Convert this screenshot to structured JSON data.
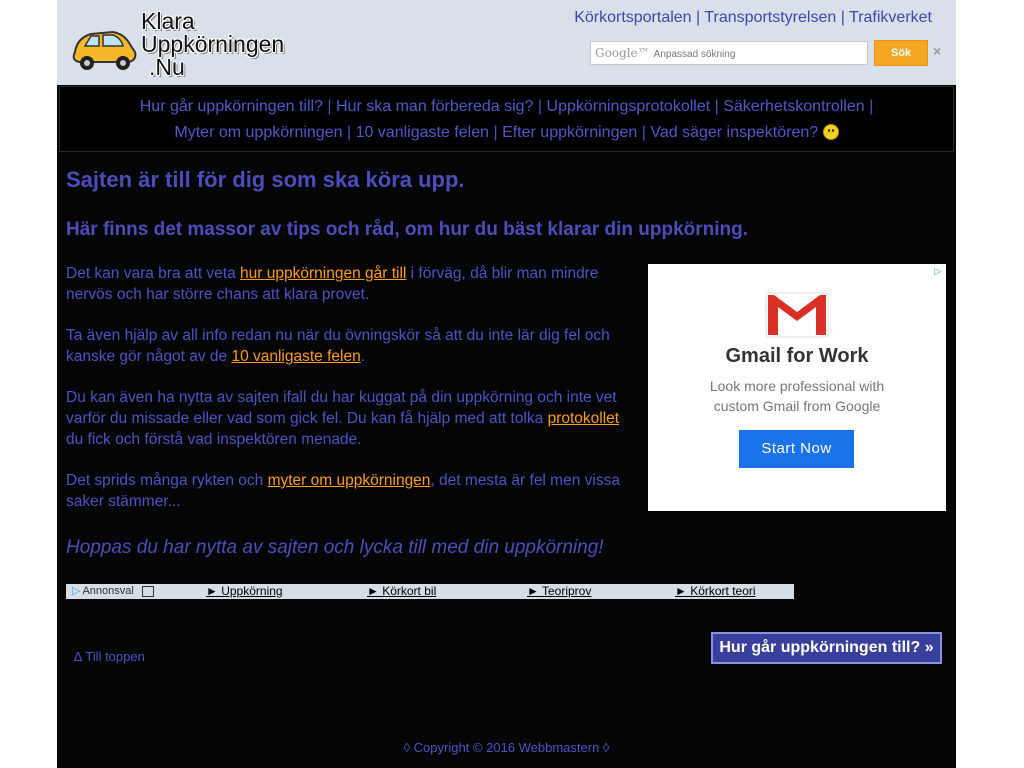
{
  "header": {
    "logo_lines": [
      "Klara",
      "Uppkörningen",
      ".Nu"
    ],
    "top_links": [
      "Körkortsportalen",
      "Transportstyrelsen",
      "Trafikverket"
    ],
    "search": {
      "brand": "Google™",
      "placeholder": "Anpassad sökning",
      "button_label": "Sök",
      "clear_icon": "×"
    }
  },
  "nav": {
    "row1": [
      "Hur går uppkörningen till?",
      "Hur ska man förbereda sig?",
      "Uppkörningsprotokollet",
      "Säkerhetskontrollen"
    ],
    "row2": [
      "Myter om uppkörningen",
      "10 vanligaste felen",
      "Efter uppkörningen",
      "Vad säger inspektören?"
    ],
    "separator": "|"
  },
  "main": {
    "headline": "Sajten är till för dig som ska köra upp.",
    "subheadline": "Här finns det massor av tips och råd, om hur du bäst klarar din uppkörning.",
    "p1": {
      "before": "Det kan vara bra att veta ",
      "link": "hur uppkörningen går till",
      "after": " i förväg, då blir man mindre nervös och har större chans att klara provet."
    },
    "p2": {
      "before": "Ta även hjälp av all info redan nu när du övningskör så att du inte lär dig fel och kanske gör något av de ",
      "link": "10 vanligaste felen",
      "after": "."
    },
    "p3": {
      "before": "Du kan även ha nytta av sajten ifall du har kuggat på din uppkörning och inte vet varför du missade eller vad som gick fel. Du kan få hjälp med att tolka ",
      "link": "protokollet",
      "after": " du fick och förstå vad inspektören menade."
    },
    "p4": {
      "before": "Det sprids många rykten och ",
      "link": "myter om uppkörningen",
      "after": ", det mesta är fel men vissa saker stämmer..."
    },
    "closing": "Hoppas du har nytta av sajten och lycka till med din uppkörning!"
  },
  "ad": {
    "title": "Gmail for Work",
    "desc_line1": "Look more professional with",
    "desc_line2": "custom Gmail from Google",
    "cta": "Start Now"
  },
  "linkbar": {
    "label": "Annonsval",
    "links": [
      "► Uppkörning",
      "► Körkort bil",
      "► Teoriprov",
      "► Körkort teori"
    ]
  },
  "bottom": {
    "to_top": "∆ Till toppen",
    "next_button": "Hur går uppkörningen till? »"
  },
  "footer": {
    "text": "◊ Copyright © 2016 Webbmastern ◊"
  },
  "colors": {
    "page_bg": "#050505",
    "header_bg": "#d9e0ea",
    "text": "#4e52c4",
    "link_highlight": "#ff9d14",
    "search_button": "#f5a623"
  }
}
